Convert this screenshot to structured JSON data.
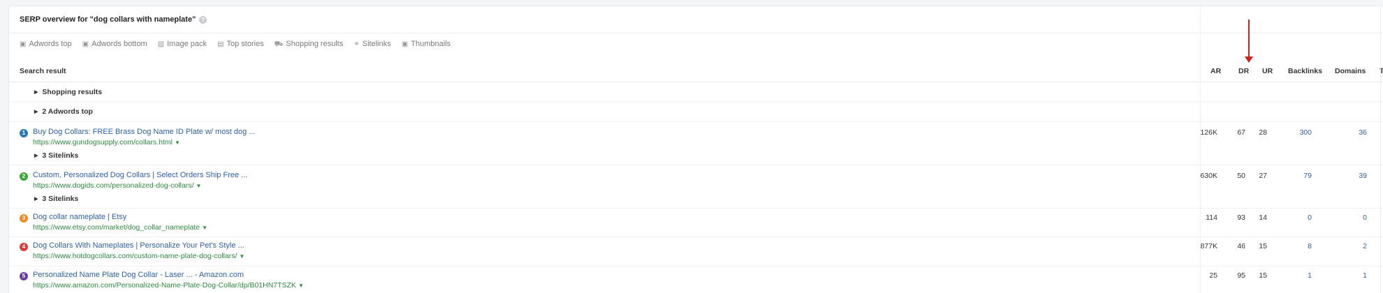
{
  "title": "SERP overview for \"dog collars with nameplate\"",
  "help_icon": "question-icon",
  "filters": [
    {
      "label": "Adwords top",
      "icon": "ad-icon",
      "glyph": "▣"
    },
    {
      "label": "Adwords bottom",
      "icon": "ad-icon",
      "glyph": "▣"
    },
    {
      "label": "Image pack",
      "icon": "image-icon",
      "glyph": "▧"
    },
    {
      "label": "Top stories",
      "icon": "news-icon",
      "glyph": "▤"
    },
    {
      "label": "Shopping results",
      "icon": "cart-icon",
      "glyph": "⛟"
    },
    {
      "label": "Sitelinks",
      "icon": "link-icon",
      "glyph": "⚭"
    },
    {
      "label": "Thumbnails",
      "icon": "thumbnail-icon",
      "glyph": "▣"
    }
  ],
  "columns": {
    "search_result": "Search result",
    "ar": "AR",
    "dr": "DR",
    "ur": "UR",
    "backlinks": "Backlinks",
    "domains": "Domains",
    "truncated": "T"
  },
  "groups": {
    "shopping": "Shopping results",
    "adwords": "2 Adwords top"
  },
  "results": [
    {
      "pos": "1",
      "color": "#2a7ab8",
      "title": "Buy Dog Collars: FREE Brass Dog Name ID Plate w/ most dog ...",
      "url": "https://www.gundogsupply.com/collars.html",
      "ar": "126K",
      "dr": "67",
      "ur": "28",
      "backlinks": "300",
      "domains": "36",
      "sitelinks": "3 Sitelinks"
    },
    {
      "pos": "2",
      "color": "#3aaa35",
      "title": "Custom, Personalized Dog Collars | Select Orders Ship Free ...",
      "url": "https://www.dogids.com/personalized-dog-collars/",
      "ar": "630K",
      "dr": "50",
      "ur": "27",
      "backlinks": "79",
      "domains": "39",
      "sitelinks": "3 Sitelinks"
    },
    {
      "pos": "3",
      "color": "#f08a24",
      "title": "Dog collar nameplate | Etsy",
      "url": "https://www.etsy.com/market/dog_collar_nameplate",
      "ar": "114",
      "dr": "93",
      "ur": "14",
      "backlinks": "0",
      "domains": "0"
    },
    {
      "pos": "4",
      "color": "#e03a3a",
      "title": "Dog Collars With Nameplates | Personalize Your Pet's Style ...",
      "url": "https://www.hotdogcollars.com/custom-name-plate-dog-collars/",
      "ar": "877K",
      "dr": "46",
      "ur": "15",
      "backlinks": "8",
      "domains": "2"
    },
    {
      "pos": "5",
      "color": "#6a3fa0",
      "title": "Personalized Name Plate Dog Collar - Laser ... - Amazon.com",
      "url": "https://www.amazon.com/Personalized-Name-Plate-Dog-Collar/dp/B01HN7TSZK",
      "ar": "25",
      "dr": "95",
      "ur": "15",
      "backlinks": "1",
      "domains": "1"
    }
  ],
  "annotation": {
    "color": "#d01f1f",
    "target": "DR column"
  }
}
